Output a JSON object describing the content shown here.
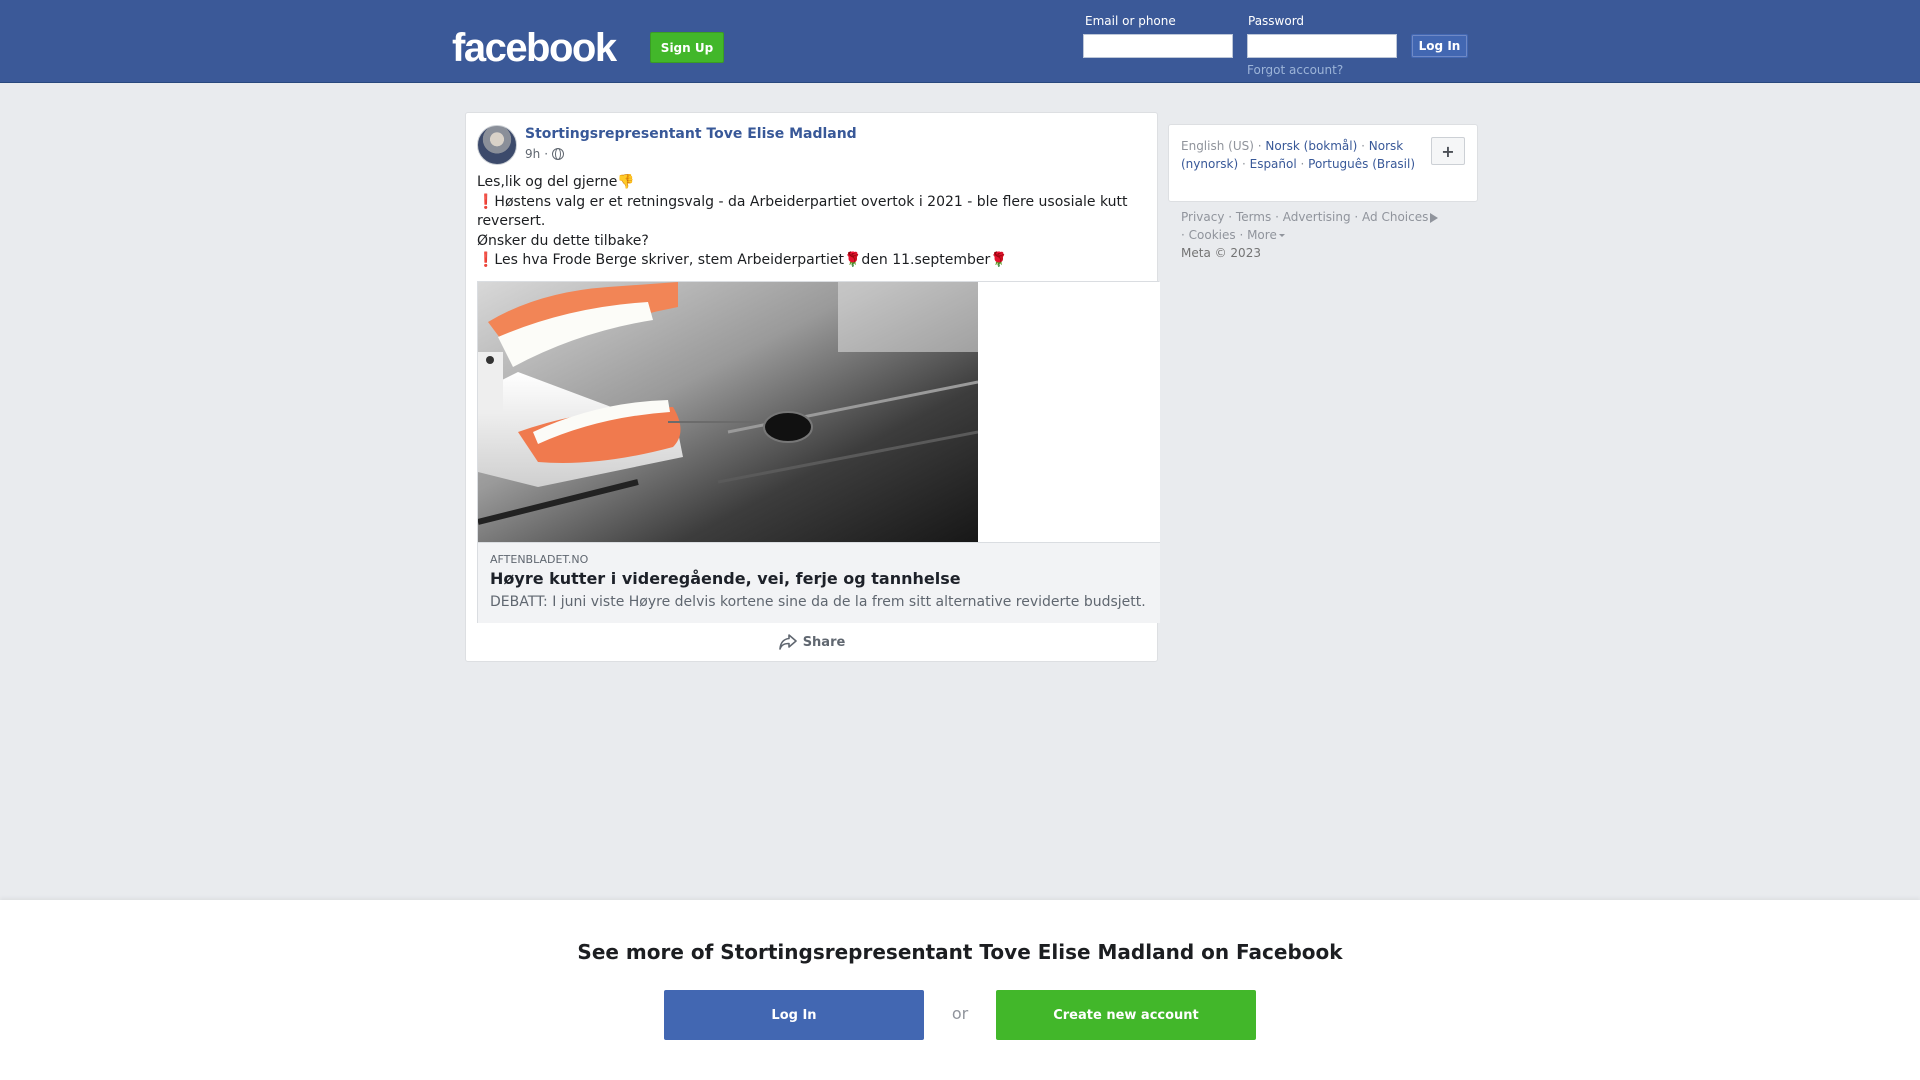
{
  "header": {
    "logo_text": "facebook",
    "signup_label": "Sign Up",
    "email_label": "Email or phone",
    "email_value": "",
    "password_label": "Password",
    "password_value": "",
    "login_label": "Log In",
    "forgot_label": "Forgot account?"
  },
  "post": {
    "author": "Stortingsrepresentant Tove Elise Madland",
    "time": "9h",
    "separator": "·",
    "lines": [
      "Les,lik og del gjerne👎",
      "❗Høstens valg er et retningsvalg - da Arbeiderpartiet overtok i 2021 - ble flere usosiale kutt reversert.",
      "Ønsker du dette tilbake?",
      "❗Les hva Frode Berge skriver, stem Arbeiderpartiet🌹den 11.september🌹"
    ],
    "link": {
      "domain": "AFTENBLADET.NO",
      "title": "Høyre kutter i videregående, vei, ferje og tannhelse",
      "description": "DEBATT: I juni viste Høyre delvis kortene sine da de la frem sitt alternative reviderte budsjett."
    },
    "share_label": "Share"
  },
  "sidebar": {
    "languages": {
      "current": "English (US)",
      "others": [
        "Norsk (bokmål)",
        "Norsk (nynorsk)",
        "Español",
        "Português (Brasil)"
      ]
    },
    "plus_label": "+",
    "footer": {
      "links": [
        "Privacy",
        "Terms",
        "Advertising",
        "Ad Choices",
        "Cookies",
        "More"
      ],
      "copyright": "Meta © 2023"
    }
  },
  "bottom_bar": {
    "heading": "See more of Stortingsrepresentant Tove Elise Madland on Facebook",
    "login_label": "Log In",
    "or_label": "or",
    "create_label": "Create new account"
  },
  "colors": {
    "brand_blue": "#3b5998",
    "button_blue": "#4267b2",
    "green": "#42b72a",
    "link_blue": "#385898",
    "background": "#e9ebee"
  }
}
